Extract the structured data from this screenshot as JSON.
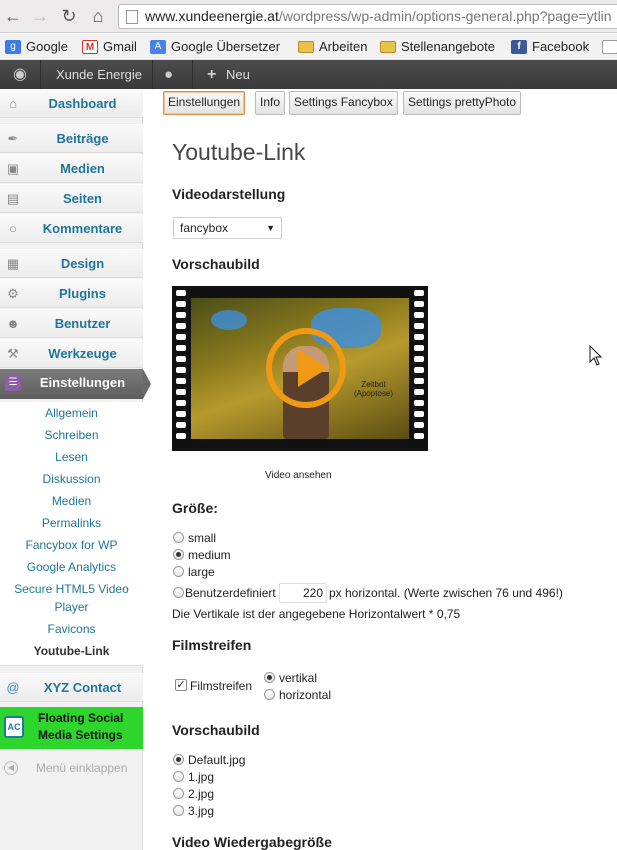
{
  "browser": {
    "url_host": "www.xundeenergie.at",
    "url_path": "/wordpress/wp-admin/options-general.php?page=ytlin",
    "bookmarks": [
      {
        "label": "Google",
        "icon": "google-icon"
      },
      {
        "label": "Gmail",
        "icon": "gmail-icon"
      },
      {
        "label": "Google Übersetzer",
        "icon": "translate-icon"
      },
      {
        "label": "Arbeiten",
        "icon": "folder-icon"
      },
      {
        "label": "Stellenangebote",
        "icon": "folder-icon"
      },
      {
        "label": "Facebook",
        "icon": "facebook-icon"
      }
    ]
  },
  "adminbar": {
    "site_name": "Xunde Energie",
    "new_label": "Neu"
  },
  "sidebar": {
    "dashboard": "Dashboard",
    "beitraege": "Beiträge",
    "medien": "Medien",
    "seiten": "Seiten",
    "kommentare": "Kommentare",
    "design": "Design",
    "plugins": "Plugins",
    "benutzer": "Benutzer",
    "werkzeuge": "Werkzeuge",
    "einstellungen": "Einstellungen",
    "submenu": {
      "allgemein": "Allgemein",
      "schreiben": "Schreiben",
      "lesen": "Lesen",
      "diskussion": "Diskussion",
      "medien": "Medien",
      "permalinks": "Permalinks",
      "fancybox": "Fancybox for WP",
      "analytics": "Google Analytics",
      "html5video": "Secure HTML5 Video Player",
      "favicons": "Favicons",
      "youtube": "Youtube-Link"
    },
    "xyz_contact": "XYZ Contact",
    "floating_social": "Floating Social Media Settings",
    "collapse": "Menü einklappen"
  },
  "tabs": {
    "einstellungen": "Einstellungen",
    "info": "Info",
    "fancybox": "Settings Fancybox",
    "prettyphoto": "Settings prettyPhoto"
  },
  "page": {
    "title": "Youtube-Link",
    "videodarstellung": "Videodarstellung",
    "select_value": "fancybox",
    "vorschaubild": "Vorschaubild",
    "thumb_text_1": "Zeitbot",
    "thumb_text_2": "(Apoptose)",
    "video_ansehen": "Video ansehen",
    "groesse": "Größe:",
    "size_small": "small",
    "size_medium": "medium",
    "size_large": "large",
    "size_custom": "Benutzerdefiniert",
    "size_value": "220",
    "size_hint": "px horizontal. (Werte zwischen 76 und 496!)",
    "vertical_note": "Die Vertikale ist der angegebene Horizontalwert * 0,75",
    "filmstreifen": "Filmstreifen",
    "filmstreifen_check": "Filmstreifen",
    "vertikal": "vertikal",
    "horizontal": "horizontal",
    "vorschaubild2": "Vorschaubild",
    "img_default": "Default.jpg",
    "img_1": "1.jpg",
    "img_2": "2.jpg",
    "img_3": "3.jpg",
    "wiedergabe": "Video Wiedergabegröße"
  }
}
